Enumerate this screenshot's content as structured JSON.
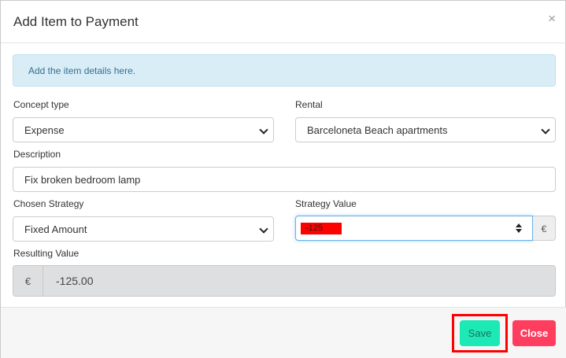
{
  "modal": {
    "title": "Add Item to Payment",
    "close_symbol": "×"
  },
  "alert": {
    "text": "Add the item details here."
  },
  "form": {
    "concept_type": {
      "label": "Concept type",
      "value": "Expense"
    },
    "rental": {
      "label": "Rental",
      "value": "Barceloneta Beach apartments"
    },
    "description": {
      "label": "Description",
      "value": "Fix broken bedroom lamp"
    },
    "chosen_strategy": {
      "label": "Chosen Strategy",
      "value": "Fixed Amount"
    },
    "strategy_value": {
      "label": "Strategy Value",
      "value": "-125",
      "addon": "€"
    },
    "resulting_value": {
      "label": "Resulting Value",
      "prefix": "€",
      "value": "-125.00"
    }
  },
  "footer": {
    "save_label": "Save",
    "close_label": "Close"
  },
  "colors": {
    "save_button": "#1de9b6",
    "close_button": "#ff3d5f",
    "alert_bg": "#d9edf7",
    "highlight": "#ff0000"
  }
}
